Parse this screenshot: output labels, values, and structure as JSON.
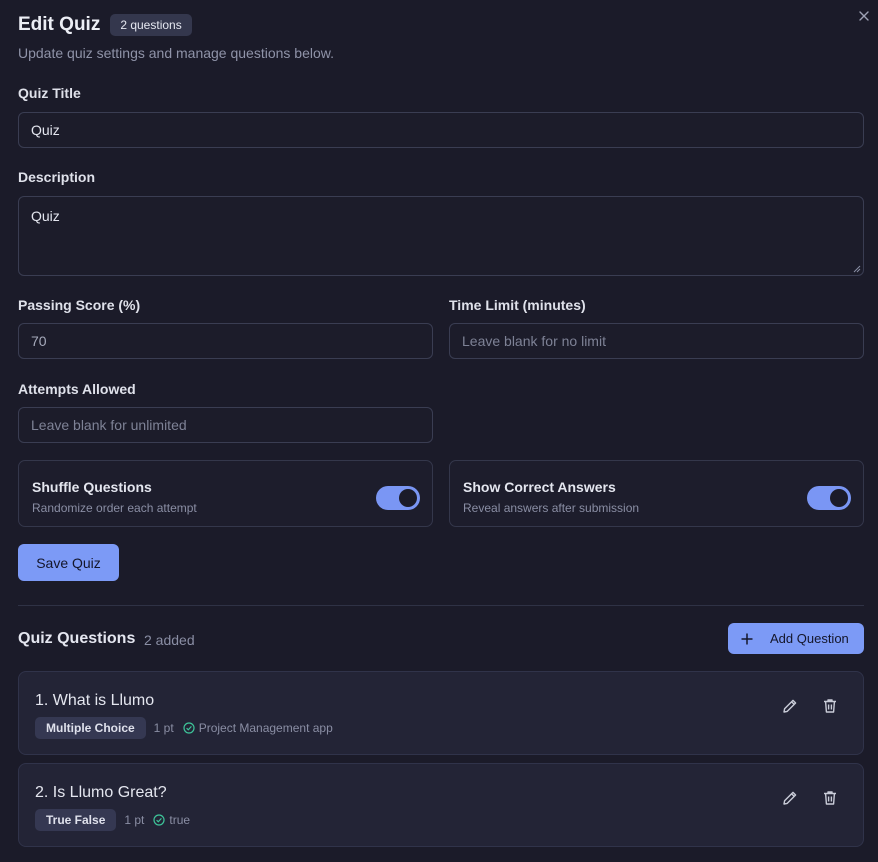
{
  "dialog": {
    "title": "Edit Quiz",
    "question_badge": "2 questions",
    "subtitle": "Update quiz settings and manage questions below."
  },
  "form": {
    "title_label": "Quiz Title",
    "title_value": "Quiz",
    "description_label": "Description",
    "description_value": "Quiz",
    "passing_label": "Passing Score (%)",
    "passing_value": "70",
    "time_label": "Time Limit (minutes)",
    "time_placeholder": "Leave blank for no limit",
    "attempts_label": "Attempts Allowed",
    "attempts_placeholder": "Leave blank for unlimited"
  },
  "toggles": {
    "shuffle": {
      "title": "Shuffle Questions",
      "description": "Randomize order each attempt",
      "on": true
    },
    "show_answers": {
      "title": "Show Correct Answers",
      "description": "Reveal answers after submission",
      "on": true
    }
  },
  "save_label": "Save Quiz",
  "questions_section": {
    "title": "Quiz Questions",
    "count": "2 added",
    "add_label": "Add Question"
  },
  "questions": [
    {
      "text": "1. What is Llumo",
      "type": "Multiple Choice",
      "points": "1 pt",
      "answer": "Project Management app"
    },
    {
      "text": "2. Is Llumo Great?",
      "type": "True False",
      "points": "1 pt",
      "answer": "true"
    }
  ],
  "colors": {
    "background": "#1b1b29",
    "accent": "#7c9af6",
    "success": "#3ec59a"
  },
  "icons": {
    "close": "close-icon",
    "plus": "plus-icon",
    "edit": "pencil-icon",
    "delete": "trash-icon",
    "correct": "check-circle-icon"
  }
}
